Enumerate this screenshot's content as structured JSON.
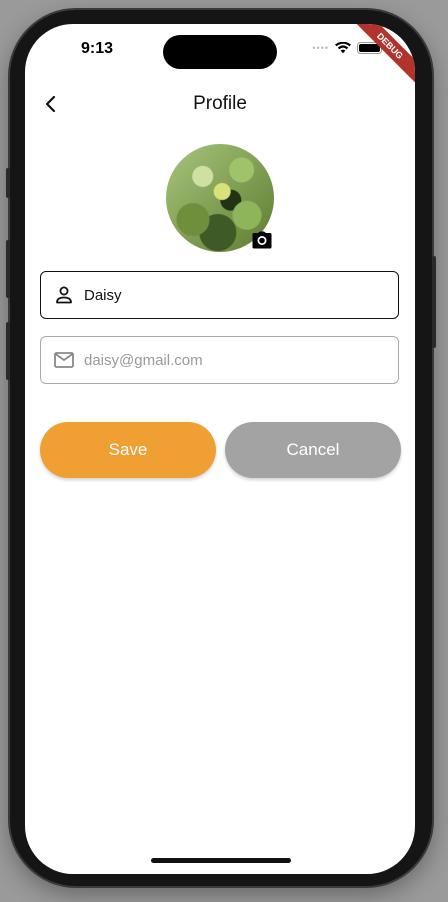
{
  "status_bar": {
    "time": "9:13",
    "debug_label": "DEBUG"
  },
  "app_bar": {
    "title": "Profile",
    "back_icon": "chevron-left-icon"
  },
  "profile": {
    "avatar_icon": "camera-icon",
    "name_field": {
      "icon": "person-icon",
      "value": "Daisy"
    },
    "email_field": {
      "icon": "mail-icon",
      "placeholder": "daisy@gmail.com"
    }
  },
  "actions": {
    "save_label": "Save",
    "cancel_label": "Cancel"
  },
  "colors": {
    "save": "#f0a033",
    "cancel": "#a3a3a3",
    "debug_banner": "#b1332b"
  }
}
